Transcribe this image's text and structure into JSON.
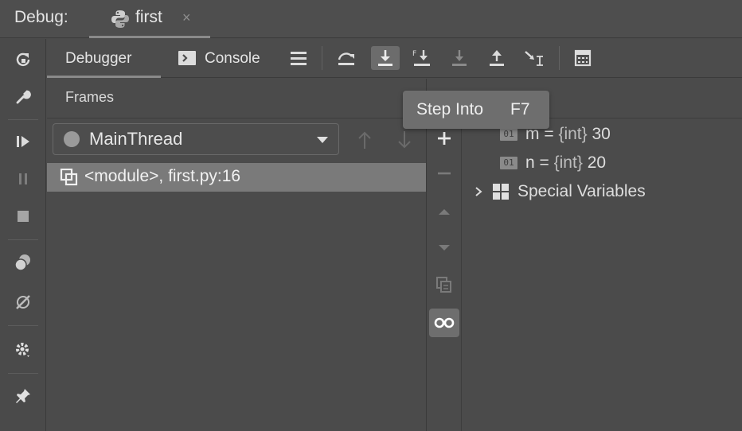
{
  "topbar": {
    "label": "Debug:",
    "run_tab": {
      "title": "first",
      "close": "×"
    }
  },
  "debugger_tabs": {
    "debugger": "Debugger",
    "console": "Console"
  },
  "toolbar_icons": [
    "menu-icon",
    "show-execution-point-icon",
    "step-over-icon",
    "step-into-icon",
    "step-into-my-code-icon",
    "force-step-into-icon",
    "step-out-icon",
    "run-to-cursor-icon",
    "evaluate-expression-icon"
  ],
  "left_icons": [
    "rerun-icon",
    "settings-wrench-icon",
    "resume-icon",
    "pause-icon",
    "stop-icon",
    "view-breakpoints-icon",
    "mute-breakpoints-icon",
    "gear-icon",
    "pin-icon"
  ],
  "frames": {
    "title": "Frames",
    "thread": "MainThread",
    "items": [
      {
        "label": "<module>, first.py:16"
      }
    ]
  },
  "variables": {
    "items": [
      {
        "badge": "01",
        "name": "m",
        "type": "{int}",
        "value": "30"
      },
      {
        "badge": "01",
        "name": "n",
        "type": "{int}",
        "value": "20"
      }
    ],
    "special": "Special Variables"
  },
  "tooltip": {
    "label": "Step Into",
    "shortcut": "F7"
  },
  "colors": {
    "background": "#4b4b4b",
    "selected_row": "#7a7a7a",
    "tooltip": "#6e6e6e"
  }
}
